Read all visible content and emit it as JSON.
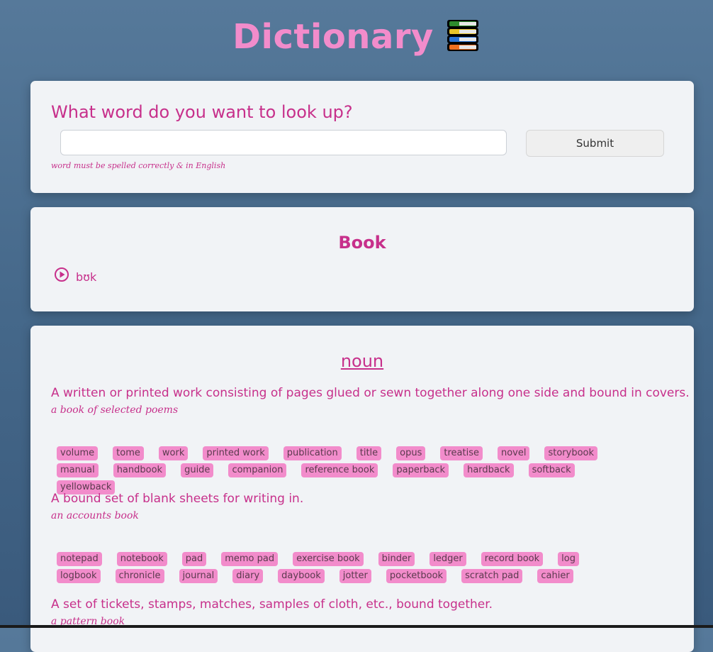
{
  "header": {
    "title": "Dictionary",
    "icon": "books-icon"
  },
  "search": {
    "heading": "What word do you want to look up?",
    "input_value": "",
    "input_placeholder": "",
    "submit_label": "Submit",
    "hint": "word must be spelled correctly & in English"
  },
  "word": {
    "title": "Book",
    "phonetic": "bʊk",
    "play_icon": "play-icon"
  },
  "meaning": {
    "part_of_speech": "noun",
    "definitions": [
      {
        "text": "A written or printed work consisting of pages glued or sewn together along one side and bound in covers.",
        "example": "a book of selected poems",
        "synonyms": [
          "volume",
          "tome",
          "work",
          "printed work",
          "publication",
          "title",
          "opus",
          "treatise",
          "novel",
          "storybook",
          "manual",
          "handbook",
          "guide",
          "companion",
          "reference book",
          "paperback",
          "hardback",
          "softback",
          "yellowback"
        ]
      },
      {
        "text": "A bound set of blank sheets for writing in.",
        "example": "an accounts book",
        "synonyms": [
          "notepad",
          "notebook",
          "pad",
          "memo pad",
          "exercise book",
          "binder",
          "ledger",
          "record book",
          "log",
          "logbook",
          "chronicle",
          "journal",
          "diary",
          "daybook",
          "jotter",
          "pocketbook",
          "scratch pad",
          "cahier"
        ]
      },
      {
        "text": "A set of tickets, stamps, matches, samples of cloth, etc., bound together.",
        "example": "a pattern book",
        "synonyms": []
      }
    ]
  },
  "colors": {
    "accent": "#c7308b",
    "chip": "#f28ccb",
    "card": "#f1f3f6"
  }
}
